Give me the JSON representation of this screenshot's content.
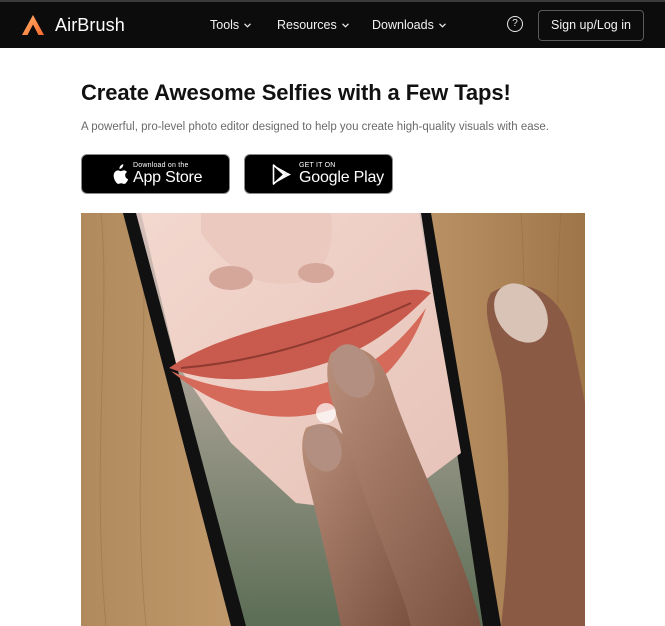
{
  "brand": {
    "name": "AirBrush",
    "logo_colors": [
      "#ff7a3d",
      "#ffb36b"
    ]
  },
  "nav": {
    "items": [
      {
        "label": "Tools",
        "icon": "chevron-down-icon"
      },
      {
        "label": "Resources",
        "icon": "chevron-down-icon"
      },
      {
        "label": "Downloads",
        "icon": "chevron-down-icon"
      }
    ],
    "help_icon": "question-circle-icon",
    "help_glyph": "?",
    "signup_label": "Sign up/Log in"
  },
  "hero": {
    "title": "Create Awesome Selfies with a Few Taps!",
    "subtitle": "A powerful, pro-level photo editor designed to help you create high-quality visuals with ease.",
    "app_store": {
      "small": "Download on the",
      "big": "App Store",
      "icon": "apple-icon"
    },
    "google_play": {
      "small": "GET IT ON",
      "big": "Google Play",
      "icon": "google-play-icon"
    },
    "image_description_icon": "photo-icon"
  },
  "colors": {
    "topbar_bg": "#0c0c0c",
    "accent": "#ff7a3d"
  }
}
